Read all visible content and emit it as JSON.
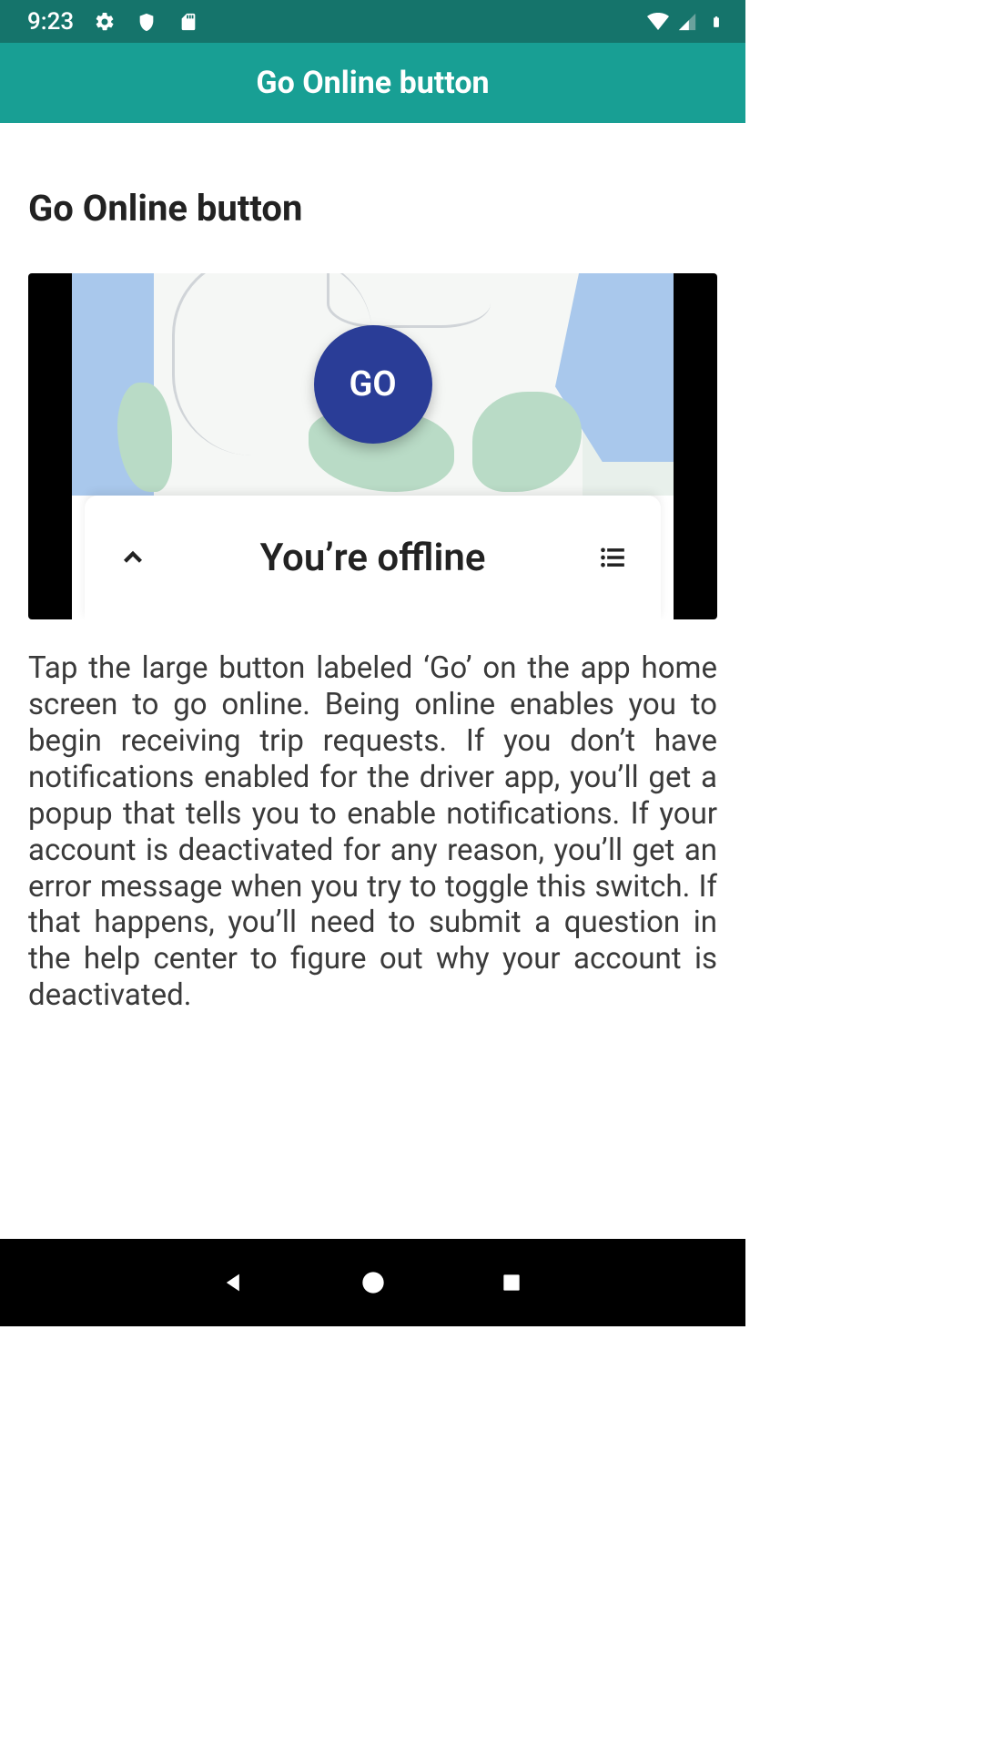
{
  "status_bar": {
    "time": "9:23"
  },
  "app_bar": {
    "title": "Go Online button"
  },
  "page": {
    "title": "Go Online button",
    "body_text": "Tap the large button labeled ‘Go’ on the app home screen to go online. Being online enables you to begin receiving trip requests. If you don’t have notifications enabled for the driver app, you’ll get a popup that tells you to enable notifications. If your account is deactivated for any reason, you’ll get an error message when you try to toggle this switch. If that happens, you’ll need to submit a question in the help center to figure out why your account is deactivated."
  },
  "screenshot": {
    "go_label": "GO",
    "offline_label": "You’re offline"
  }
}
